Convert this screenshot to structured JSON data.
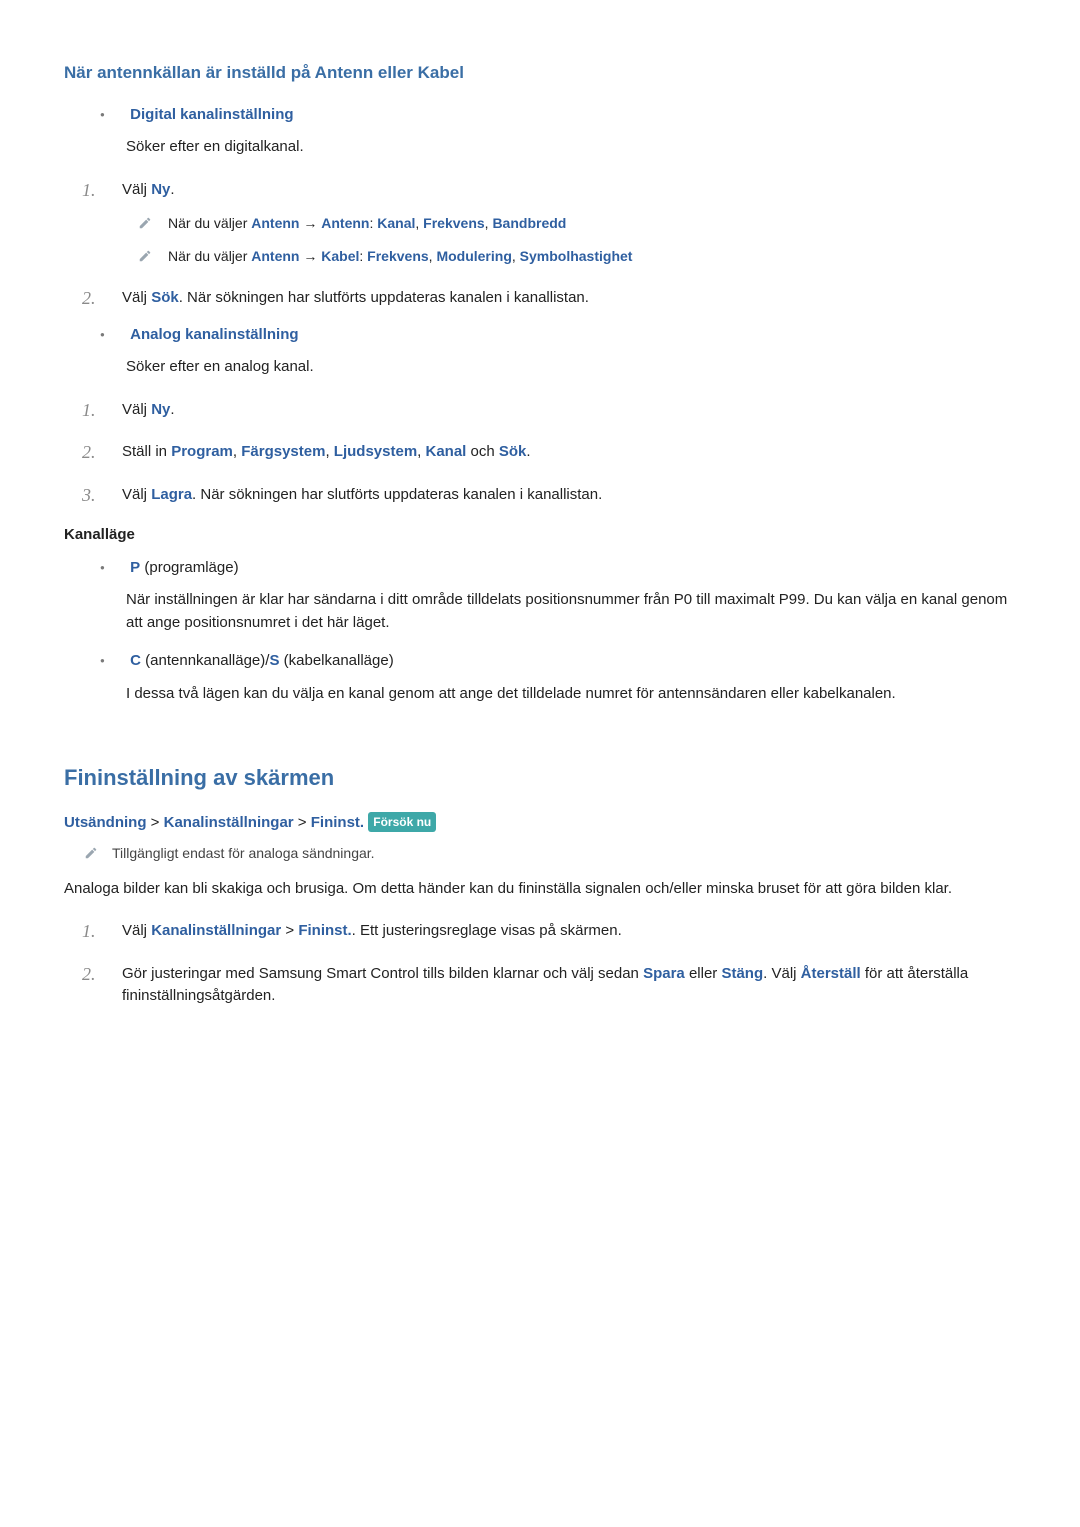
{
  "section1": {
    "heading": "När antennkällan är inställd på Antenn eller Kabel",
    "digital": {
      "title": "Digital kanalinställning",
      "desc": "Söker efter en digitalkanal.",
      "steps": [
        {
          "num": "1.",
          "pre": "Välj ",
          "blue1": "Ny",
          "post": "."
        },
        {
          "num": "2.",
          "pre": "Välj ",
          "blue1": "Sök",
          "post": ". När sökningen har slutförts uppdateras kanalen i kanallistan."
        }
      ],
      "notes": [
        {
          "pre": "När du väljer ",
          "segs": [
            {
              "t": "Antenn",
              "b": true
            },
            {
              "t": " → "
            },
            {
              "t": "Antenn",
              "b": true
            },
            {
              "t": ": "
            },
            {
              "t": "Kanal",
              "b": true
            },
            {
              "t": ", "
            },
            {
              "t": "Frekvens",
              "b": true
            },
            {
              "t": ", "
            },
            {
              "t": "Bandbredd",
              "b": true
            }
          ]
        },
        {
          "pre": "När du väljer ",
          "segs": [
            {
              "t": "Antenn",
              "b": true
            },
            {
              "t": " → "
            },
            {
              "t": "Kabel",
              "b": true
            },
            {
              "t": ": "
            },
            {
              "t": "Frekvens",
              "b": true
            },
            {
              "t": ", "
            },
            {
              "t": "Modulering",
              "b": true
            },
            {
              "t": ", "
            },
            {
              "t": "Symbolhastighet",
              "b": true
            }
          ]
        }
      ]
    },
    "analog": {
      "title": "Analog kanalinställning",
      "desc": "Söker efter en analog kanal.",
      "steps": {
        "s1": {
          "num": "1.",
          "pre": "Välj ",
          "blue1": "Ny",
          "post": "."
        },
        "s2": {
          "num": "2.",
          "pre": "Ställ in ",
          "segs": [
            {
              "t": "Program",
              "b": true
            },
            {
              "t": ", "
            },
            {
              "t": "Färgsystem",
              "b": true
            },
            {
              "t": ", "
            },
            {
              "t": "Ljudsystem",
              "b": true
            },
            {
              "t": ", "
            },
            {
              "t": "Kanal",
              "b": true
            },
            {
              "t": " och "
            },
            {
              "t": "Sök",
              "b": true
            },
            {
              "t": "."
            }
          ]
        },
        "s3": {
          "num": "3.",
          "pre": "Välj ",
          "blue1": "Lagra",
          "post": ". När sökningen har slutförts uppdateras kanalen i kanallistan."
        }
      }
    },
    "kanallage": {
      "heading": "Kanalläge",
      "items": {
        "p": {
          "label": "P",
          "note": " (programläge)",
          "desc": "När inställningen är klar har sändarna i ditt område tilldelats positionsnummer från P0 till maximalt P99. Du kan välja en kanal genom att ange positionsnumret i det här läget."
        },
        "cs": {
          "label1": "C",
          "note1": " (antennkanalläge)/",
          "label2": "S",
          "note2": " (kabelkanalläge)",
          "desc": "I dessa två lägen kan du välja en kanal genom att ange det tilldelade numret för antennsändaren eller kabelkanalen."
        }
      }
    }
  },
  "section2": {
    "heading": "Fininställning av skärmen",
    "path": {
      "p1": "Utsändning",
      "sep": " > ",
      "p2": "Kanalinställningar",
      "p3": "Fininst.",
      "badge": "Försök nu"
    },
    "note": "Tillgängligt endast för analoga sändningar.",
    "body": "Analoga bilder kan bli skakiga och brusiga. Om detta händer kan du fininställa signalen och/eller minska bruset för att göra bilden klar.",
    "steps": {
      "s1": {
        "num": "1.",
        "pre": "Välj ",
        "segs": [
          {
            "t": "Kanalinställningar",
            "b": true
          },
          {
            "t": " > "
          },
          {
            "t": "Fininst.",
            "b": true
          },
          {
            "t": ". Ett justeringsreglage visas på skärmen."
          }
        ]
      },
      "s2": {
        "num": "2.",
        "pre": "Gör justeringar med Samsung Smart Control tills bilden klarnar och välj sedan ",
        "segs": [
          {
            "t": "Spara",
            "b": true
          },
          {
            "t": " eller "
          },
          {
            "t": "Stäng",
            "b": true
          },
          {
            "t": ". Välj "
          },
          {
            "t": "Återställ",
            "b": true
          },
          {
            "t": " för att återställa fininställningsåtgärden."
          }
        ]
      }
    }
  }
}
